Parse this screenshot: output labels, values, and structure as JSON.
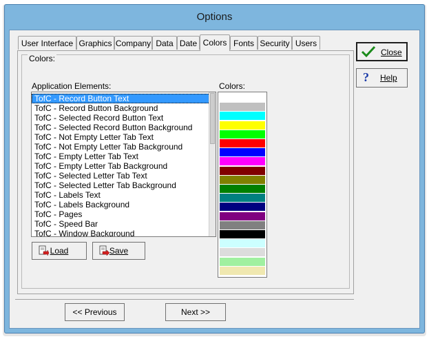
{
  "window": {
    "title": "Options"
  },
  "tabs": [
    {
      "label": "User Interface"
    },
    {
      "label": "Graphics"
    },
    {
      "label": "Company"
    },
    {
      "label": "Data"
    },
    {
      "label": "Date"
    },
    {
      "label": "Colors"
    },
    {
      "label": "Fonts"
    },
    {
      "label": "Security"
    },
    {
      "label": "Users"
    }
  ],
  "active_tab": "Colors",
  "colors_group": {
    "legend": "Colors:",
    "elements_label": "Application Elements:",
    "colors_label": "Colors:",
    "items": [
      "TofC - Record Button Text",
      "TofC - Record Button Background",
      "TofC - Selected Record Button Text",
      "TofC - Selected Record Button Background",
      "TofC - Not Empty Letter Tab Text",
      "TofC - Not Empty Letter Tab Background",
      "TofC - Empty Letter Tab Text",
      "TofC - Empty Letter Tab Background",
      "TofC - Selected Letter Tab Text",
      "TofC - Selected Letter Tab Background",
      "TofC - Labels Text",
      "TofC - Labels Background",
      "TofC - Pages",
      "TofC - Speed Bar",
      "TofC - Window Background"
    ],
    "selected_index": 0,
    "swatches": [
      "#ffffff",
      "#c0c0c0",
      "#00ffff",
      "#ffff00",
      "#00ff00",
      "#ff0000",
      "#0000ff",
      "#ff00ff",
      "#800000",
      "#808000",
      "#008000",
      "#008080",
      "#000080",
      "#800080",
      "#808080",
      "#000000",
      "#ccffff",
      "#dcdcdc",
      "#a0f0a0",
      "#f0e8b0"
    ]
  },
  "buttons": {
    "load": {
      "label": "Load",
      "icon": "load-icon"
    },
    "save": {
      "label": "Save",
      "icon": "save-icon"
    },
    "close": {
      "label": "Close",
      "icon": "checkmark-icon"
    },
    "help": {
      "label": "Help",
      "icon": "question-icon"
    },
    "previous": {
      "label": "<< Previous"
    },
    "next": {
      "label": "Next >>"
    }
  }
}
